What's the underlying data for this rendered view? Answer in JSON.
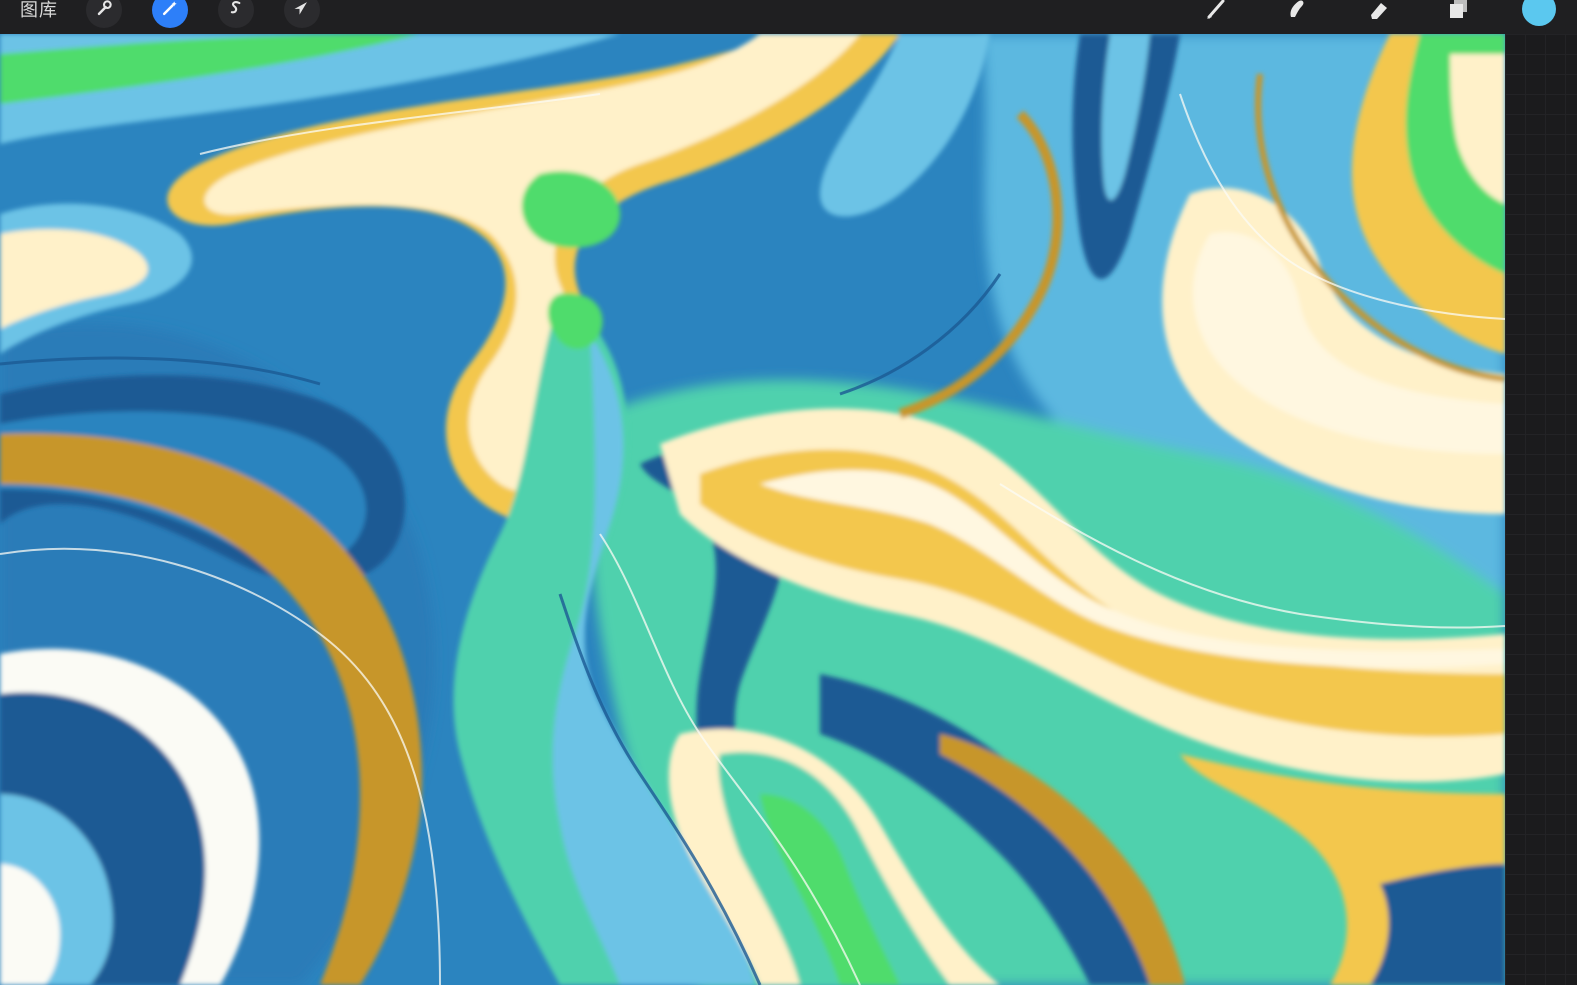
{
  "toolbar": {
    "gallery_label": "图库",
    "left_tools": [
      {
        "icon": "wrench-icon",
        "active": false
      },
      {
        "icon": "magic-wand-icon",
        "active": true
      },
      {
        "icon": "selection-s-icon",
        "active": false
      },
      {
        "icon": "arrow-cursor-icon",
        "active": false
      }
    ],
    "right_tools": [
      {
        "icon": "brush-icon"
      },
      {
        "icon": "smudge-icon"
      },
      {
        "icon": "eraser-icon"
      },
      {
        "icon": "layers-icon"
      }
    ],
    "current_color": "#5bc8ef"
  },
  "canvas": {
    "palette": {
      "deep_blue": "#1c5a94",
      "mid_blue": "#2b84bf",
      "sky_blue": "#6cc3e6",
      "teal": "#4fd1ad",
      "green": "#4fdc6c",
      "cream": "#fff1c9",
      "yellow": "#f3c74e",
      "ochre": "#c7962b",
      "white": "#fbfbf5"
    }
  }
}
